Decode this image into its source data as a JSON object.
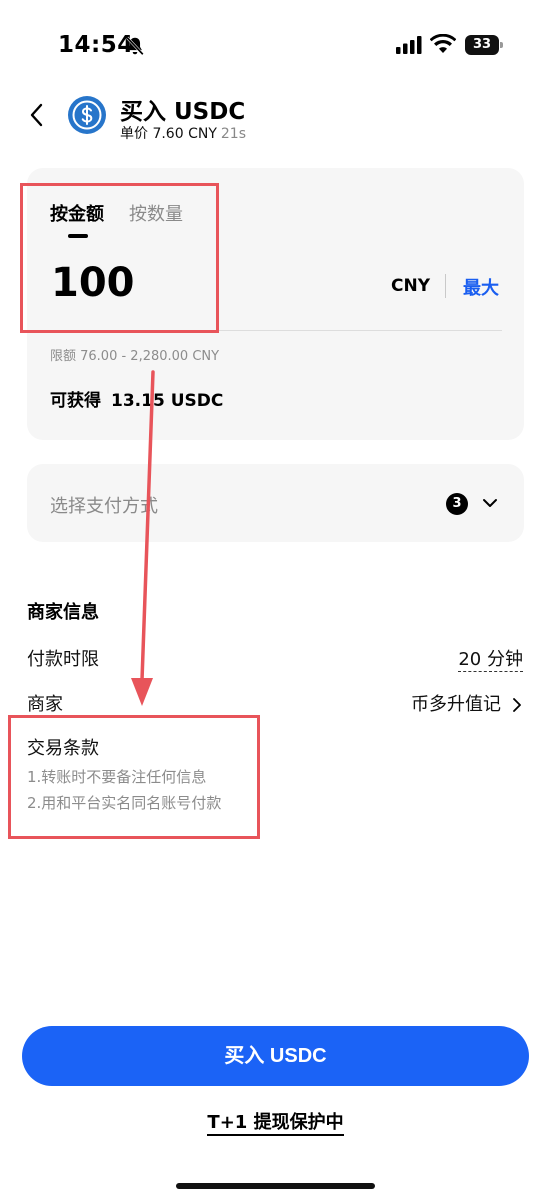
{
  "status_bar": {
    "time": "14:54",
    "battery": "33"
  },
  "nav": {
    "title": "买入 USDC",
    "unit_price": "单价 7.60 CNY",
    "countdown": "21s"
  },
  "amount_card": {
    "tab_amount": "按金额",
    "tab_quantity": "按数量",
    "amount": "100",
    "currency": "CNY",
    "max_label": "最大",
    "limit": "限额 76.00 - 2,280.00 CNY",
    "obtain_label": "可获得",
    "obtain_value": "13.15 USDC"
  },
  "payment": {
    "placeholder": "选择支付方式",
    "count": "3"
  },
  "merchant_info": {
    "title": "商家信息",
    "payment_limit_label": "付款时限",
    "payment_limit_value": "20 分钟",
    "merchant_label": "商家",
    "merchant_value": "币多升值记",
    "terms_title": "交易条款",
    "terms": [
      "1.转账时不要备注任何信息",
      "2.用和平台实名同名账号付款"
    ]
  },
  "actions": {
    "buy_label": "买入 USDC",
    "protection_label": "T+1 提现保护中"
  },
  "colors": {
    "accent": "#1b63f6",
    "annotation": "#e8545a",
    "card_bg": "#f6f6f6"
  }
}
